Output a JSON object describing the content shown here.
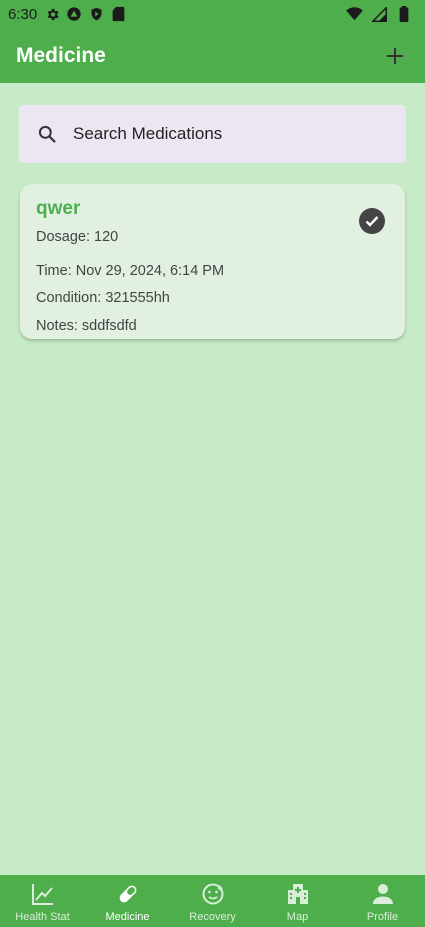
{
  "status_bar": {
    "time": "6:30",
    "left_icons": [
      "settings-icon",
      "android-icon",
      "shield-icon",
      "sd-card-icon"
    ],
    "right_icons": [
      "wifi-icon",
      "signal-icon",
      "battery-icon"
    ]
  },
  "app_bar": {
    "title": "Medicine",
    "add_icon": "plus-icon"
  },
  "search": {
    "placeholder": "Search Medications",
    "value": ""
  },
  "medications": [
    {
      "name": "qwer",
      "dosage": "Dosage: 120",
      "time": "Time: Nov 29, 2024, 6:14 PM",
      "condition": "Condition: 321555hh",
      "notes": "Notes: sddfsdfd",
      "taken": true
    }
  ],
  "bottom_nav": {
    "items": [
      {
        "label": "Health Stat",
        "icon": "chart-line-icon",
        "active": false
      },
      {
        "label": "Medicine",
        "icon": "pill-icon",
        "active": true
      },
      {
        "label": "Recovery",
        "icon": "face-icon",
        "active": false
      },
      {
        "label": "Map",
        "icon": "hospital-icon",
        "active": false
      },
      {
        "label": "Profile",
        "icon": "person-icon",
        "active": false
      }
    ]
  },
  "colors": {
    "primary": "#4fae4c",
    "background": "#c6ebc6",
    "card": "#e1f0e1",
    "search_bg": "#ece6f2",
    "accent_text": "#4caf50"
  }
}
